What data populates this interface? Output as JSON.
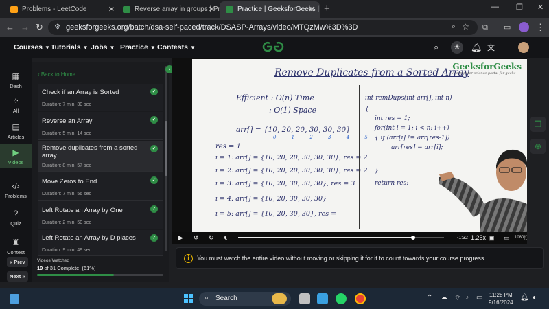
{
  "tabs": [
    {
      "title": "Problems - LeetCode",
      "favicon_color": "#ffa116"
    },
    {
      "title": "Reverse array in groups | Practic",
      "favicon_color": "#2f8d46"
    },
    {
      "title": "Practice | GeeksforGeeks | A co",
      "favicon_color": "#2f8d46"
    }
  ],
  "address": {
    "url": "geeksforgeeks.org/batch/dsa-self-paced/track/DSASP-Arrays/video/MTQzMw%3D%3D"
  },
  "site_nav": {
    "items": [
      "Courses",
      "Tutorials",
      "Jobs",
      "Practice",
      "Contests"
    ],
    "logo": "GG"
  },
  "rail": {
    "items": [
      {
        "label": "Dash",
        "icon": "grid-icon"
      },
      {
        "label": "All",
        "icon": "apps-icon"
      },
      {
        "label": "Articles",
        "icon": "article-icon"
      },
      {
        "label": "Videos",
        "icon": "video-icon"
      },
      {
        "label": "Problems",
        "icon": "code-icon"
      },
      {
        "label": "Quiz",
        "icon": "question-icon"
      },
      {
        "label": "Contest",
        "icon": "trophy-icon"
      }
    ],
    "prev": "« Prev",
    "next": "Next »"
  },
  "panel": {
    "back": "Back to Home",
    "videos": [
      {
        "title": "Check if an Array is Sorted",
        "duration": "Duration: 7 min, 30 sec"
      },
      {
        "title": "Reverse an Array",
        "duration": "Duration: 5 min, 14 sec"
      },
      {
        "title": "Remove duplicates from a sorted array",
        "duration": "Duration: 8 min, 57 sec"
      },
      {
        "title": "Move Zeros to End",
        "duration": "Duration: 7 min, 56 sec"
      },
      {
        "title": "Left Rotate an Array by One",
        "duration": "Duration: 2 min, 50 sec"
      },
      {
        "title": "Left Rotate an Array by D places",
        "duration": "Duration: 9 min, 49 sec"
      }
    ],
    "progress": {
      "label": "Videos Watched",
      "done": "19",
      "of": "of",
      "total": "31",
      "tail": "Complete. (61%)",
      "fraction": 0.61
    }
  },
  "video": {
    "board_title": "Remove Duplicates from a Sorted Array",
    "brand": "GeeksforGeeks",
    "brand_tag": "A computer science portal for geeks",
    "efficient": "Efficient : O(n) Time",
    "space": ": O(1) Space",
    "arr": "arr[] = {10, 20, 20, 30, 30, 30}",
    "idx": "0 1 2 3 4 5",
    "res": "res = 1",
    "lines": [
      "i = 1:  arr[] = {10, 20, 20, 30, 30, 30}, res = 2",
      "i = 2:  arr[] = {10, 20, 20, 30, 30, 30}, res = 2",
      "i = 3:  arr[] = {10, 20, 30, 30, 30}, res = 3",
      "i = 4:  arr[] = {10, 20, 30, 30, 30}",
      "i = 5:  arr[] = {10, 20, 30, 30}, res ="
    ],
    "code": [
      "int remDups(int arr[], int n)",
      "{",
      "int res = 1;",
      "for(int i = 1; i < n; i++)",
      "{   if (arr[i] != arr[res-1])",
      "    arr[res] = arr[i];",
      "}",
      "return res;"
    ],
    "time_elapsed": "-1:32",
    "speed": "1.25x",
    "quality": "1080p",
    "seek_fraction": 0.85
  },
  "notice": {
    "text": "You must watch the entire video without moving or skipping it for it to count towards your course progress."
  },
  "taskbar": {
    "search": "Search",
    "time": "11:28 PM",
    "date": "9/16/2024"
  }
}
